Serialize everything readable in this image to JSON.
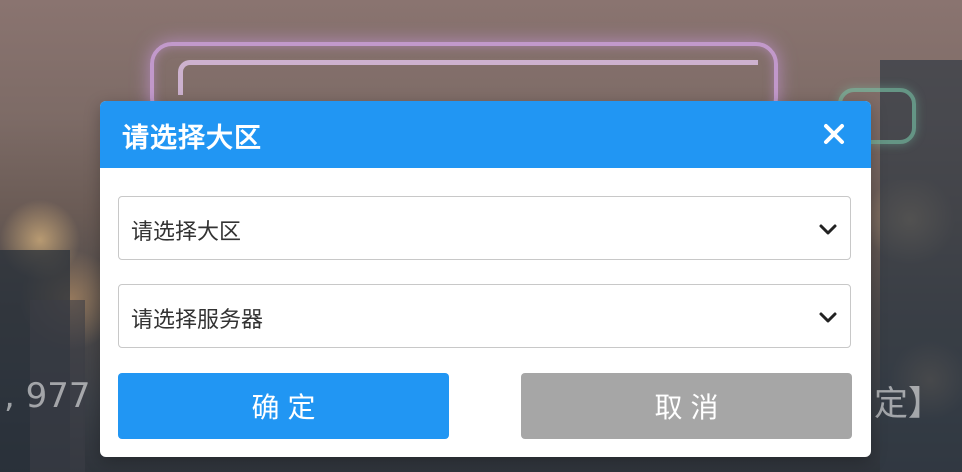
{
  "background": {
    "left_text": ", 977",
    "right_text": "定】"
  },
  "dialog": {
    "title": "请选择大区",
    "close_glyph": "×",
    "region_select": {
      "placeholder": "请选择大区"
    },
    "server_select": {
      "placeholder": "请选择服务器"
    },
    "confirm_label": "确定",
    "cancel_label": "取消"
  },
  "colors": {
    "header": "#2196f3",
    "confirm": "#2196f3",
    "cancel": "#a6a6a6"
  },
  "icons": [
    "close-icon",
    "chevron-down-icon"
  ]
}
